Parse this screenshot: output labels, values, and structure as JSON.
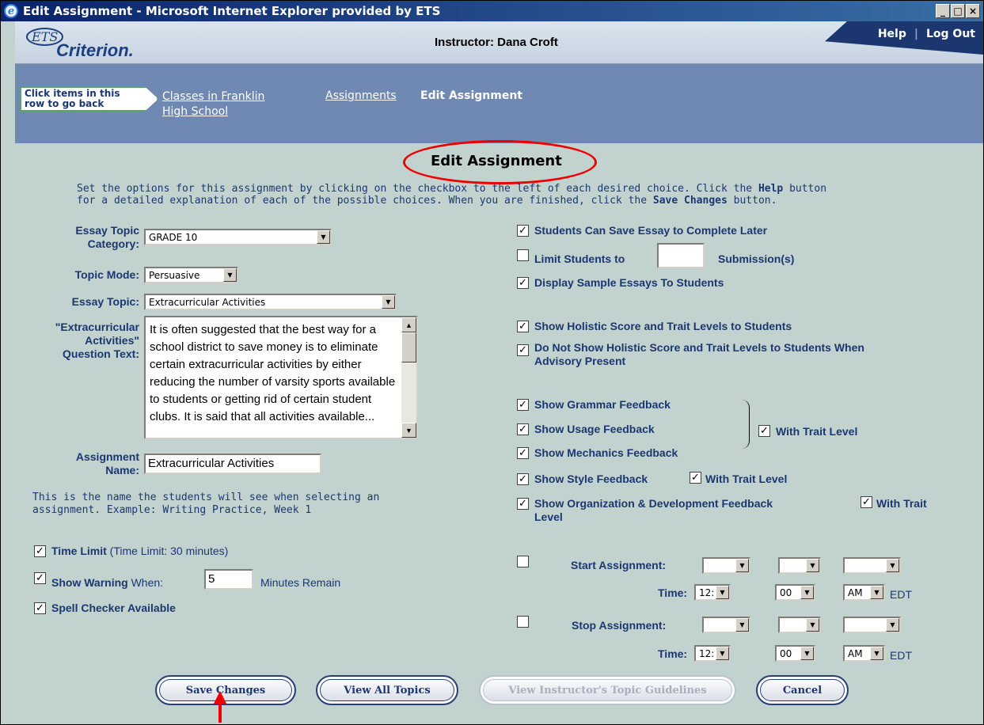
{
  "window": {
    "title": "Edit Assignment - Microsoft Internet Explorer provided by ETS",
    "controls": [
      "_",
      "□",
      "×"
    ]
  },
  "header": {
    "logo_ets": "ETS",
    "logo_criterion": "Criterion.",
    "instructor": "Instructor: Dana Croft",
    "help": "Help",
    "separator": "|",
    "logout": "Log Out"
  },
  "breadcrumb": {
    "go_back_line1": "Click items in this",
    "go_back_line2": "row to go back",
    "classes_line1": "Classes in Franklin",
    "classes_line2": "High School",
    "assignments": "Assignments",
    "current": "Edit Assignment"
  },
  "page": {
    "title": "Edit Assignment",
    "instructions_line1_a": "Set the options for this assignment by clicking on the checkbox to the left of each desired choice. Click the ",
    "instructions_line1_b": "Help",
    "instructions_line1_c": " button",
    "instructions_line2_a": "for a detailed explanation of each of the possible choices. When you are finished, click the ",
    "instructions_line2_b": "Save Changes",
    "instructions_line2_c": " button."
  },
  "form": {
    "category_label_1": "Essay Topic",
    "category_label_2": "Category:",
    "category_value": "GRADE 10",
    "mode_label": "Topic Mode:",
    "mode_value": "Persuasive",
    "topic_label": "Essay Topic:",
    "topic_value": "Extracurricular Activities",
    "question_label_1": "\"Extracurricular",
    "question_label_2": "Activities\"",
    "question_label_3": "Question Text:",
    "question_text": "It is often suggested that the best way for a school district to save money is to eliminate certain extracurricular activities by either reducing the number of varsity sports available to students or getting rid of certain student clubs. It is said that all activities available...",
    "name_label_1": "Assignment",
    "name_label_2": "Name:",
    "name_value": "Extracurricular Activities",
    "name_help_1": "This is the name the students will see when selecting an",
    "name_help_2": "assignment. Example: Writing Practice, Week 1",
    "time_limit": "Time Limit",
    "time_limit_note": "(Time Limit: 30 minutes)",
    "show_warning": "Show Warning",
    "when": "When:",
    "warning_minutes": "5",
    "minutes_remain": "Minutes Remain",
    "spell_checker": "Spell Checker Available"
  },
  "options": {
    "save_later": "Students Can Save Essay to Complete Later",
    "limit_students": "Limit Students to",
    "limit_value": "",
    "submissions": "Submission(s)",
    "display_samples": "Display Sample Essays To Students",
    "show_holistic": "Show Holistic Score and Trait Levels to Students",
    "dont_show_1": "Do Not Show Holistic Score and Trait Levels to Students When",
    "dont_show_2": "Advisory Present",
    "grammar": "Show Grammar Feedback",
    "usage": "Show Usage Feedback",
    "mechanics": "Show Mechanics Feedback",
    "with_trait_level": "With Trait Level",
    "style": "Show Style Feedback",
    "organization": "Show Organization & Development Feedback",
    "with_trait": "With Trait",
    "level": "Level",
    "start_label": "Start Assignment:",
    "stop_label": "Stop Assignment:",
    "time_label": "Time:",
    "hour": "12:",
    "minute": "00",
    "ampm": "AM",
    "tz": "EDT",
    "check": "✓",
    "arrow": "▼"
  },
  "buttons": {
    "save": "Save Changes",
    "view_all": "View All Topics",
    "guidelines": "View Instructor's Topic Guidelines",
    "cancel": "Cancel"
  },
  "colors": {
    "annotation": "#e00000",
    "accent": "#1c3770"
  }
}
